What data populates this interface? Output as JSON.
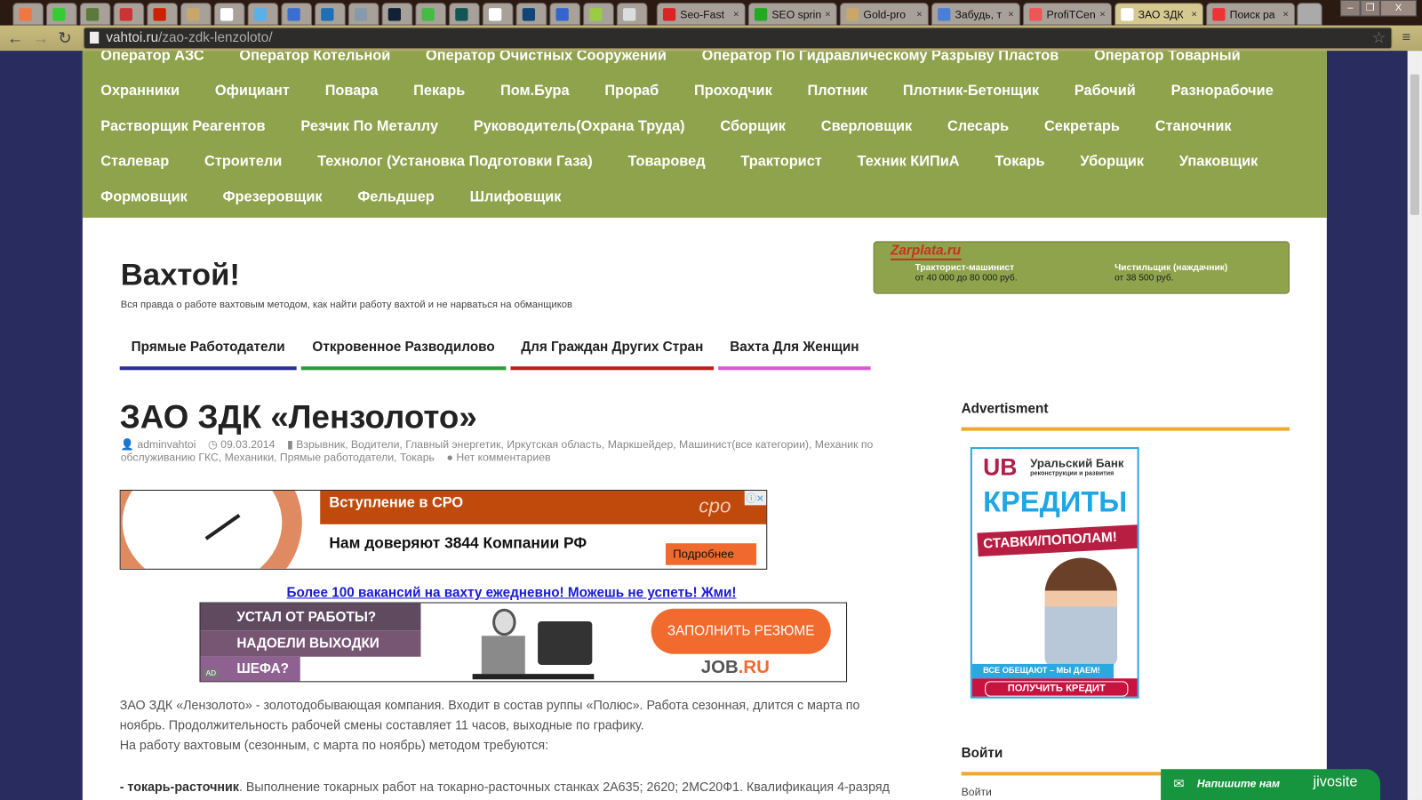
{
  "browser": {
    "tabs": [
      {
        "label": "Seo-Fast",
        "color": "#d22"
      },
      {
        "label": "SEO sprint",
        "color": "#2a2"
      },
      {
        "label": "Gold-pro",
        "color": "#c9a76a"
      },
      {
        "label": "Забудь, т",
        "color": "#4a7fd8"
      },
      {
        "label": "ProfiTCen",
        "color": "#e55"
      },
      {
        "label": "ЗАО ЗДК",
        "color": "#fff",
        "active": true
      },
      {
        "label": "Поиск ра",
        "color": "#e33"
      }
    ],
    "pinned_tab_colors": [
      "#e74",
      "#3c3",
      "#5a7a3a",
      "#c33",
      "#c20",
      "#c9a76a",
      "#fff",
      "#5ab0e8",
      "#3a6fd0",
      "#1e6fb8",
      "#8899aa",
      "#123",
      "#4b4",
      "#155",
      "#fff",
      "#147",
      "#36c",
      "#9c4",
      "#ddd"
    ],
    "close_glyph": "×",
    "url_host": "vahtoi.ru",
    "url_path": "/zao-zdk-lenzoloto/",
    "window_controls": [
      "–",
      "❐",
      "X"
    ]
  },
  "nav": {
    "rows": [
      [
        "Оператор АЗС",
        "Оператор Котельной",
        "Оператор Очистных Сооружений",
        "Оператор По Гидравлическому Разрыву Пластов",
        "Оператор Товарный"
      ],
      [
        "Охранники",
        "Официант",
        "Повара",
        "Пекарь",
        "Пом.Бура",
        "Прораб",
        "Проходчик",
        "Плотник",
        "Плотник-Бетонщик",
        "Рабочий",
        "Разнорабочие"
      ],
      [
        "Растворщик Реагентов",
        "Резчик По Металлу",
        "Руководитель(Охрана Труда)",
        "Сборщик",
        "Сверловщик",
        "Слесарь",
        "Секретарь",
        "Станочник"
      ],
      [
        "Сталевар",
        "Строители",
        "Технолог (Установка Подготовки Газа)",
        "Товаровед",
        "Тракторист",
        "Техник КИПиА",
        "Токарь",
        "Уборщик",
        "Упаковщик"
      ],
      [
        "Формовщик",
        "Фрезеровщик",
        "Фельдшер",
        "Шлифовщик"
      ]
    ]
  },
  "site": {
    "title": "Вахтой!",
    "tagline": "Вся правда о работе вахтовым методом, как найти работу вахтой и не нарваться на обманщиков"
  },
  "zarplata": {
    "logo": "Zarplata.ru",
    "jobs": [
      {
        "title": "Тракторист-машинист",
        "salary": "от 40 000 до 80 000 руб."
      },
      {
        "title": "Чистильщик (наждачник)",
        "salary": "от 38 500 руб."
      }
    ]
  },
  "menu": [
    {
      "label": "Прямые Работодатели",
      "color": "#2b2f8f"
    },
    {
      "label": "Откровенное Разводилово",
      "color": "#2a9a3a"
    },
    {
      "label": "Для Граждан Других Стран",
      "color": "#c01d1d"
    },
    {
      "label": "Вахта Для Женщин",
      "color": "#d65ad6"
    }
  ],
  "post": {
    "title": "ЗАО ЗДК «Лензолото»",
    "author": "adminvahtoi",
    "date": "09.03.2014",
    "categories": "Взрывник, Водители, Главный энергетик, Иркутская область, Маркшейдер, Машинист(все категории), Механик по обслуживанию ГКС, Механики, Прямые работодатели, Токарь",
    "comments": "Нет комментариев",
    "paragraphs": [
      "ЗАО ЗДК «Лензолото» -  золотодобывающая компания. Входит в состав руппы «Полюс». Работа сезонная,  длится с марта по",
      "ноябрь.  Продолжительность рабочей смены составляет 11 часов, выходные по графику.",
      "На работу вахтовым (сезонным, с марта по ноябрь) методом требуются:"
    ],
    "item_bold": "- токарь-расточник",
    "item_text": ". Выполнение токарных работ на токарно-расточных станках 2А635; 2620; 2МС20Ф1.  Квалификация 4-разряд"
  },
  "ad1": {
    "header": "Вступление в СРО",
    "logo": "срo",
    "body": "Нам доверяют 3844 Компании РФ",
    "button": "Подробнее"
  },
  "promo_link": "Более 100 вакансий на вахту ежедневно! Можешь не успеть! Жми!",
  "ad2": {
    "lines": [
      "УСТАЛ ОТ РАБОТЫ?",
      "НАДОЕЛИ ВЫХОДКИ",
      "ШЕФА?"
    ],
    "button": "ЗАПОЛНИТЬ РЕЗЮМЕ",
    "logo_a": "JOB",
    "logo_b": ".RU",
    "badge": "AD"
  },
  "sidebar": {
    "ad_heading": "Advertisment",
    "bank": {
      "name": "Уральский Банк",
      "sub": "реконструкции и развития",
      "headline": "КРЕДИТЫ",
      "ribbon": "СТАВКИ/ПОПОЛАМ!",
      "tag": "ВСЕ ОБЕЩАЮТ – МЫ ДАЕМ!",
      "button": "ПОЛУЧИТЬ КРЕДИТ"
    },
    "login_heading": "Войти",
    "login_link": "Войти"
  },
  "chat": {
    "label": "Напишите нам",
    "brand": "jivosite"
  }
}
